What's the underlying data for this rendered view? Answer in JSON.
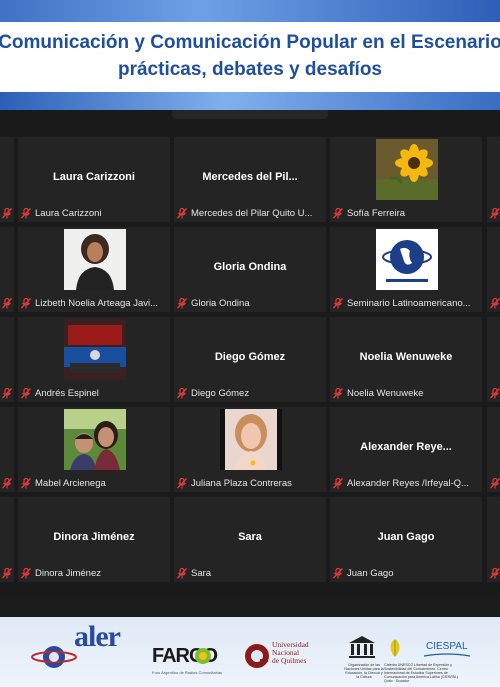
{
  "header": {
    "title_line1": "Comunicación y Comunicación Popular en el Escenario",
    "title_line2": "prácticas, debates y desafíos"
  },
  "participants": [
    {
      "display": "Laura Carizzoni",
      "label": "Laura Carizzoni",
      "avatar": "none"
    },
    {
      "display": "Mercedes del Pil...",
      "label": "Mercedes del Pilar Quito U...",
      "avatar": "none"
    },
    {
      "display": "",
      "label": "Sofía Ferreira",
      "avatar": "sunflower"
    },
    {
      "display": "",
      "label": "Lizbeth Noelia Arteaga Javi...",
      "avatar": "woman-portrait"
    },
    {
      "display": "Gloria Ondina",
      "label": "Gloria Ondina",
      "avatar": "none"
    },
    {
      "display": "",
      "label": "Seminario Latinoamericano...",
      "avatar": "globe-logo"
    },
    {
      "display": "",
      "label": "Andrés Espinel",
      "avatar": "tv-studio"
    },
    {
      "display": "Diego Gómez",
      "label": "Diego Gómez",
      "avatar": "none"
    },
    {
      "display": "Noelia Wenuweke",
      "label": "Noelia Wenuweke",
      "avatar": "none"
    },
    {
      "display": "",
      "label": "Mabel Arcienega",
      "avatar": "family-photo"
    },
    {
      "display": "",
      "label": "Juliana Plaza Contreras",
      "avatar": "girl-portrait"
    },
    {
      "display": "Alexander  Reye...",
      "label": "Alexander Reyes /Irfeyal-Q...",
      "avatar": "none"
    },
    {
      "display": "Dinora Jiménez",
      "label": "Dinora Jiménez",
      "avatar": "none"
    },
    {
      "display": "Sara",
      "label": "Sara",
      "avatar": "none"
    },
    {
      "display": "Juan Gago",
      "label": "Juan Gago",
      "avatar": "none"
    }
  ],
  "logos": {
    "aler": "aler",
    "farco": "FARCO",
    "farco_sub": "Foro Argentino de Radios Comunitarias",
    "unq": "Universidad\nNacional\nde Quilmes",
    "unesco": "Organización de las Naciones Unidas para la Educación, la Ciencia y la Cultura",
    "unesco_chair": "Cátedra UNESCO Libertad de Expresión y Sostenibilidad del Conocimiento. Centro Internacional de Estudios Superiores de Comunicación para América Latina (CIESPAL) Quito · Ecuador",
    "ciespal": "CIESPAL"
  },
  "colors": {
    "title_blue": "#1f4f9c",
    "tile_bg": "#242424",
    "mic_muted": "#e23a3a"
  }
}
